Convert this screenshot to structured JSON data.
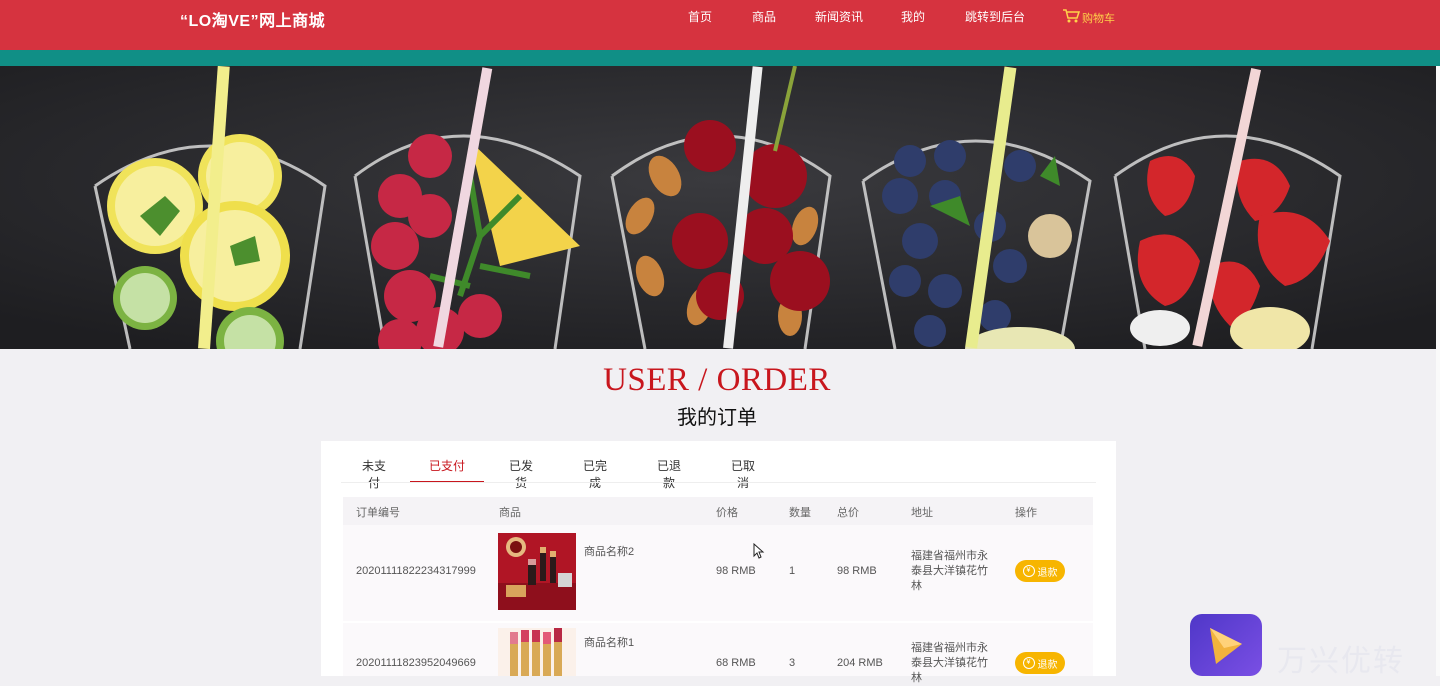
{
  "header": {
    "logo": "“LO淘VE”网上商城",
    "nav": [
      "首页",
      "商品",
      "新闻资讯",
      "我的",
      "跳转到后台"
    ],
    "cart_label": "购物车",
    "cart_icon": "cart-icon"
  },
  "page": {
    "title_en": "USER / ORDER",
    "title_cn": "我的订单"
  },
  "tabs": [
    "未支付",
    "已支付",
    "已发货",
    "已完成",
    "已退款",
    "已取消"
  ],
  "active_tab": "已支付",
  "table": {
    "headers": [
      "订单编号",
      "商品",
      "价格",
      "数量",
      "总价",
      "地址",
      "操作"
    ],
    "rows": [
      {
        "order_no": "20201111822234317999",
        "product": "商品名称2",
        "price": "98 RMB",
        "qty": "1",
        "total": "98 RMB",
        "address": "福建省福州市永泰县大洋镇花竹林",
        "action": "退款"
      },
      {
        "order_no": "20201111823952049669",
        "product": "商品名称1",
        "price": "68 RMB",
        "qty": "3",
        "total": "204 RMB",
        "address": "福建省福州市永泰县大洋镇花竹林",
        "action": "退款"
      }
    ]
  },
  "watermark": "万兴优转",
  "colors": {
    "brand_red": "#d6333f",
    "teal_strip": "#108f86",
    "title_red": "#c8161d",
    "refund_button": "#f7b500"
  }
}
